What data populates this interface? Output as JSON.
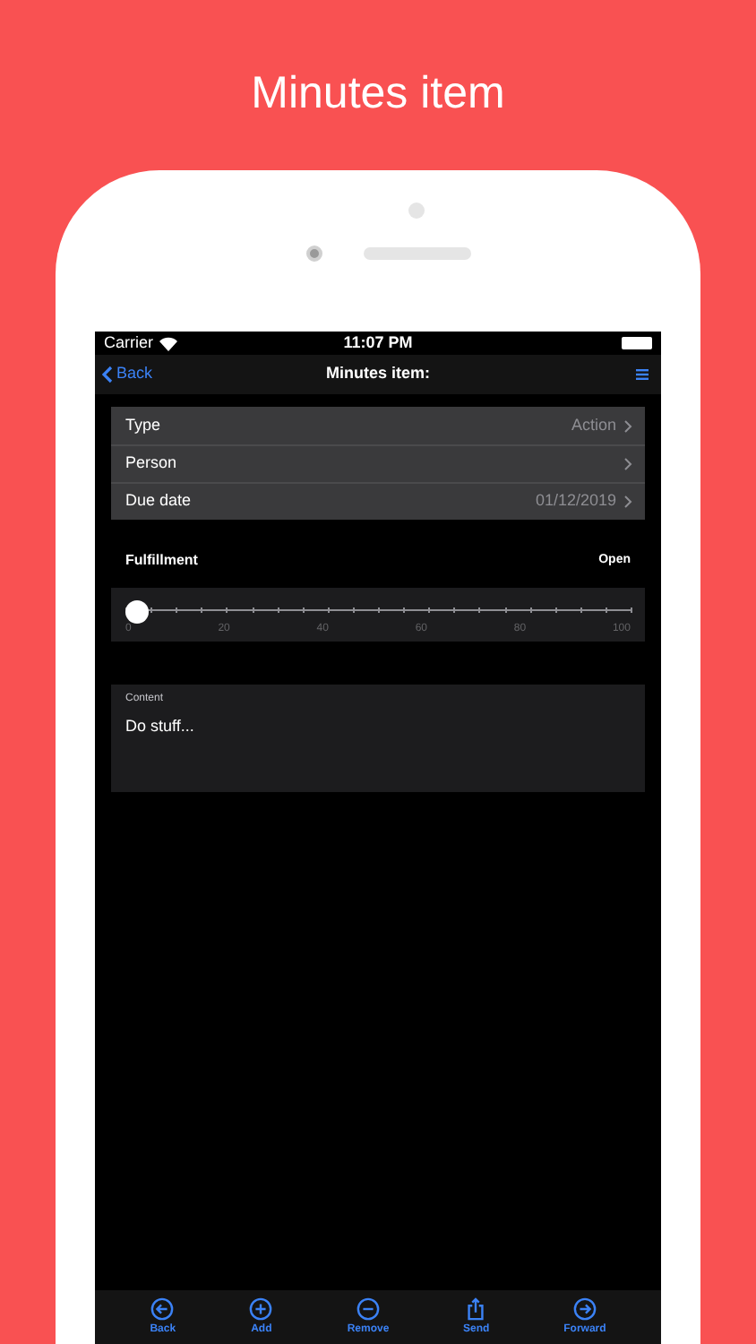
{
  "headline": "Minutes item",
  "status_bar": {
    "carrier": "Carrier",
    "time": "11:07 PM"
  },
  "nav_bar": {
    "back": "Back",
    "title": "Minutes item:"
  },
  "fields": [
    {
      "label": "Type",
      "value": "Action"
    },
    {
      "label": "Person"
    },
    {
      "label": "Due date",
      "value": "01/12/2019"
    }
  ],
  "fulfillment": {
    "label": "Fulfillment",
    "status": "Open",
    "level": 0,
    "tick_labels": [
      "0",
      "20",
      "40",
      "60",
      "80",
      "100"
    ]
  },
  "content": {
    "label": "Content",
    "value": "Do stuff..."
  },
  "toolbar": [
    {
      "kind": "back",
      "label": "Back"
    },
    {
      "kind": "add",
      "label": "Add"
    },
    {
      "kind": "remove",
      "label": "Remove"
    },
    {
      "kind": "send",
      "label": "Send"
    },
    {
      "kind": "forward",
      "label": "Forward"
    }
  ]
}
